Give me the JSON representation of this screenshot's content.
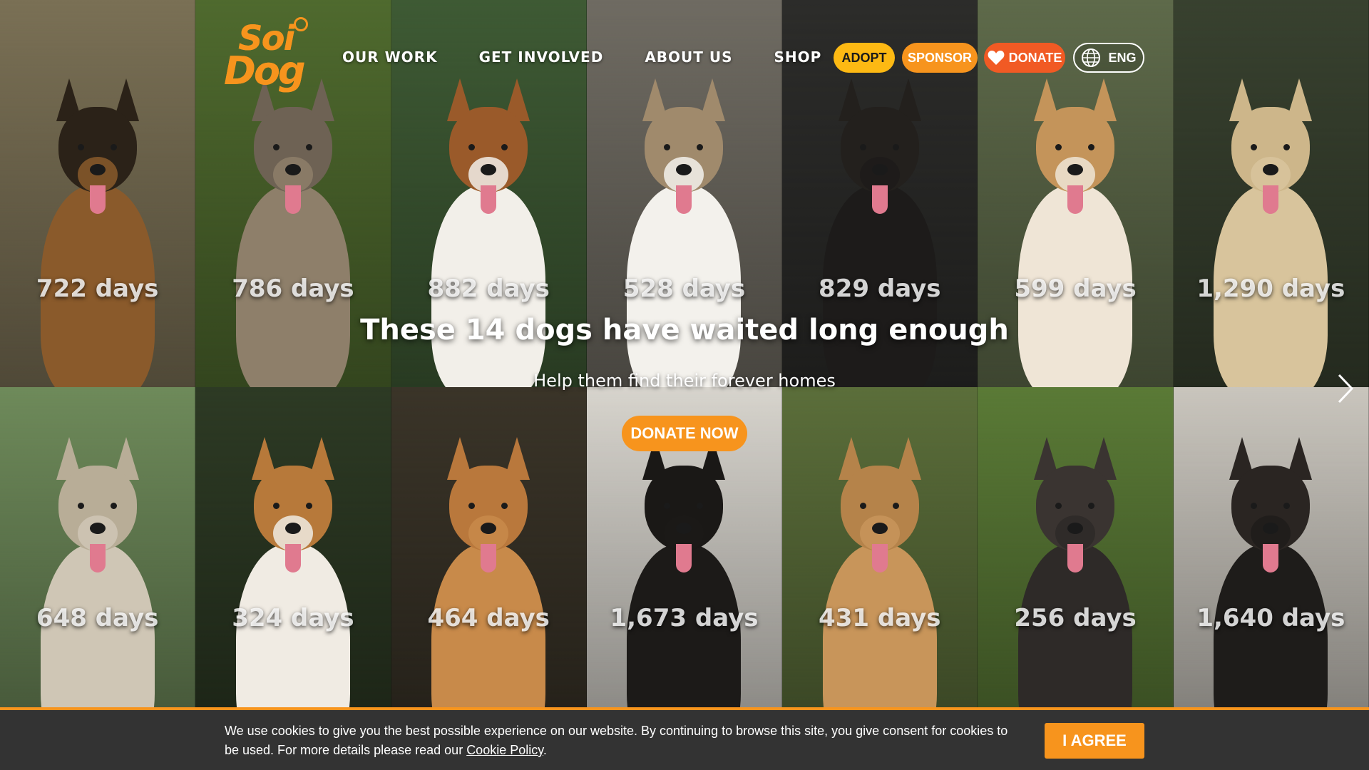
{
  "brand": {
    "logo_line1": "Soi",
    "logo_line2": "Dog"
  },
  "nav": {
    "items": [
      {
        "label": "OUR WORK"
      },
      {
        "label": "GET INVOLVED"
      },
      {
        "label": "ABOUT US"
      },
      {
        "label": "SHOP"
      }
    ],
    "adopt_label": "ADOPT",
    "sponsor_label": "SPONSOR",
    "donate_label": "DONATE",
    "language_label": "ENG"
  },
  "hero": {
    "title": "These 14 dogs have waited long enough",
    "subtitle": "Help them find their forever homes",
    "cta_label": "DONATE NOW"
  },
  "dogs": [
    {
      "days": "722 days",
      "bg": "#7a7055",
      "coat": "#8a5a2b",
      "face": "#2b2218"
    },
    {
      "days": "786 days",
      "bg": "#4f6a2e",
      "coat": "#8e7f6a",
      "face": "#6e6254"
    },
    {
      "days": "882 days",
      "bg": "#3e5a34",
      "coat": "#f2efe9",
      "face": "#9a5a2a"
    },
    {
      "days": "528 days",
      "bg": "#6f6b62",
      "coat": "#f3f1ec",
      "face": "#a08a6c"
    },
    {
      "days": "829 days",
      "bg": "#2c2c2a",
      "coat": "#1d1b1a",
      "face": "#23201d"
    },
    {
      "days": "599 days",
      "bg": "#5e6a4a",
      "coat": "#efe5d6",
      "face": "#c4945a"
    },
    {
      "days": "1,290 days",
      "bg": "#38412f",
      "coat": "#d8c49c",
      "face": "#cdb68a"
    },
    {
      "days": "648 days",
      "bg": "#6e8a5a",
      "coat": "#cfc6b5",
      "face": "#b8ad97"
    },
    {
      "days": "324 days",
      "bg": "#2d3a24",
      "coat": "#f0ebe3",
      "face": "#b7793a"
    },
    {
      "days": "464 days",
      "bg": "#3a3428",
      "coat": "#c88a4a",
      "face": "#b9783c"
    },
    {
      "days": "1,673 days",
      "bg": "#d7d4cd",
      "coat": "#1c1a18",
      "face": "#1a1816"
    },
    {
      "days": "431 days",
      "bg": "#5b6e3a",
      "coat": "#c8955a",
      "face": "#b5834a"
    },
    {
      "days": "256 days",
      "bg": "#5a7a36",
      "coat": "#2e2a28",
      "face": "#3a3431"
    },
    {
      "days": "1,640 days",
      "bg": "#c9c5bd",
      "coat": "#1e1c1a",
      "face": "#2a2522"
    }
  ],
  "cookie": {
    "text": "We use cookies to give you the best possible experience on our website. By continuing to browse this site, you give consent for cookies to be used. For more details please read our ",
    "link_label": "Cookie Policy",
    "text_end": ".",
    "agree_label": "I AGREE"
  },
  "colors": {
    "brand_orange": "#f7941d",
    "adopt_yellow": "#fdb913",
    "donate_red": "#f15a24"
  }
}
